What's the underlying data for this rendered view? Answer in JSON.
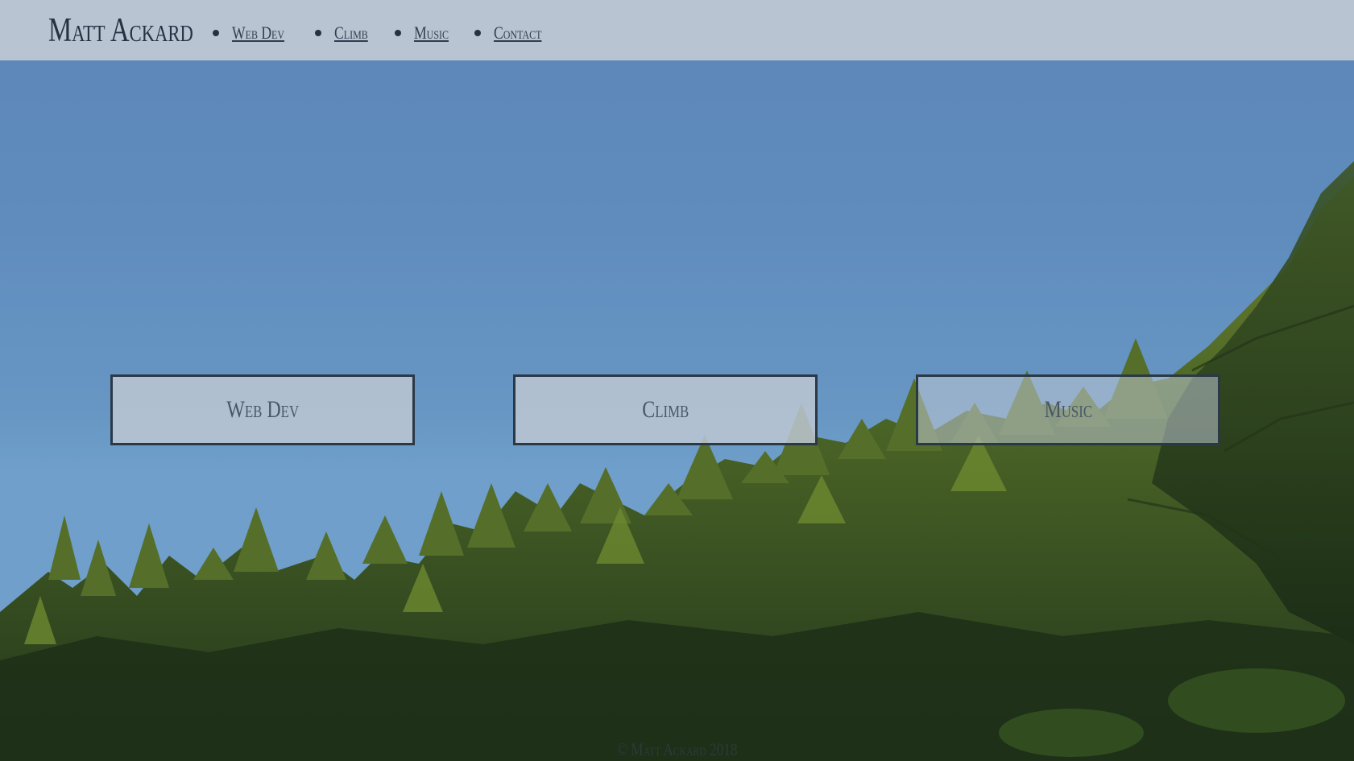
{
  "header": {
    "title": "Matt Ackard",
    "nav": [
      {
        "label": "Web Dev"
      },
      {
        "label": "Climb"
      },
      {
        "label": "Music"
      },
      {
        "label": "Contact"
      }
    ]
  },
  "cards": [
    {
      "label": "Web Dev"
    },
    {
      "label": "Climb"
    },
    {
      "label": "Music"
    }
  ],
  "footer": {
    "text": "© Matt Ackard 2018"
  },
  "colors": {
    "header_bg": "#bdc7d2",
    "text_dark": "#233244",
    "sky": "#5f8cbd",
    "forest": "#2f4a22"
  }
}
